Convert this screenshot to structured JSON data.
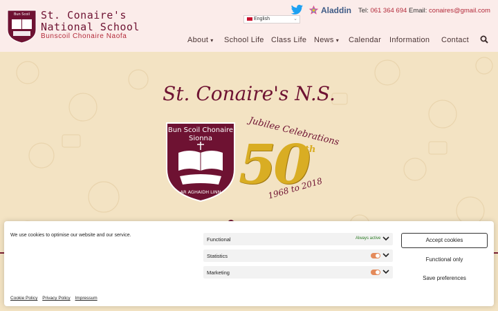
{
  "header": {
    "school_name_line1": "St. Conaire's",
    "school_name_line2": "National School",
    "school_name_irish": "Bunscoil Chonaire Naofa",
    "crest_text": "Bun Scoil Chonaire Sionna",
    "language": "English",
    "aladdin_label": "Aladdin",
    "tel_label": "Tel:",
    "tel_value": "061 364 694",
    "email_label": "Email:",
    "email_value": "conaires@gmail.com"
  },
  "nav": {
    "items": [
      {
        "label": "About",
        "dropdown": true
      },
      {
        "label": "School Life",
        "dropdown": false
      },
      {
        "label": "Class Life",
        "dropdown": false
      },
      {
        "label": "News",
        "dropdown": true
      },
      {
        "label": "Calendar",
        "dropdown": false
      },
      {
        "label": "Information",
        "dropdown": false
      },
      {
        "label": "Contact",
        "dropdown": false
      }
    ],
    "dropdown_arrow": "▾"
  },
  "hero": {
    "title": "St. Conaire's N.S.",
    "subtitle": "Jubilee Celebrations",
    "anniversary_number": "50",
    "anniversary_suffix": "th",
    "years": "1968 to 2018",
    "crest_top": "Bun Scoil Chonaire",
    "crest_mid": "Sionna",
    "crest_motto": "AR AGHAIDH LINN"
  },
  "cookie": {
    "message": "We use cookies to optimise our website and our service.",
    "preferences": [
      {
        "label": "Functional",
        "status": "Always active"
      },
      {
        "label": "Statistics",
        "status": ""
      },
      {
        "label": "Marketing",
        "status": ""
      }
    ],
    "accept_label": "Accept cookies",
    "functional_only_label": "Functional only",
    "save_label": "Save preferences",
    "links": [
      "Cookie Policy",
      "Privacy Policy",
      "Impressum"
    ]
  },
  "colors": {
    "brand_maroon": "#6e1232",
    "accent_red": "#b32a3a",
    "gold": "#d9ad23",
    "toggle_orange": "#e48a5a",
    "active_green": "#2b7a24"
  },
  "icons": [
    "crest-logo-icon",
    "twitter-icon",
    "aladdin-star-icon",
    "search-icon",
    "chevron-down-icon"
  ]
}
